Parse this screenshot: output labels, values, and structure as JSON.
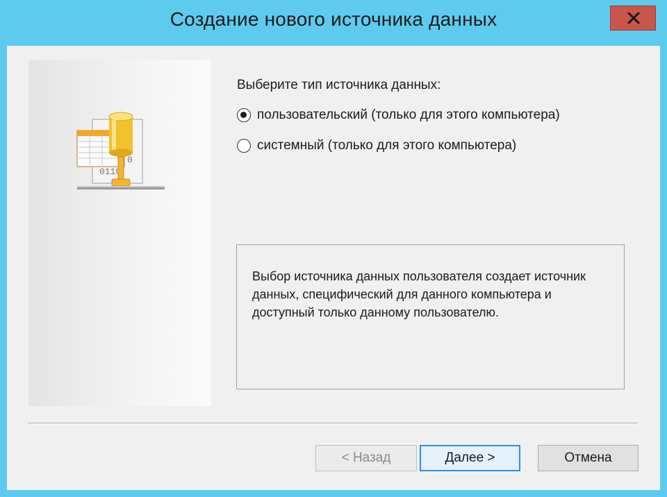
{
  "window": {
    "title": "Создание нового источника данных",
    "close_label": "x"
  },
  "icons": {
    "close": "close-icon",
    "datasource": "datasource-icon"
  },
  "main": {
    "prompt": "Выберите тип источника данных:",
    "options": [
      {
        "label": "пользовательский (только для этого компьютера)",
        "checked": true
      },
      {
        "label": "системный (только для этого компьютера)",
        "checked": false
      }
    ],
    "description": "Выбор источника данных пользователя создает источник данных, специфический для данного компьютера и доступный только данному пользователю."
  },
  "buttons": {
    "back": "< Назад",
    "next": "Далее >",
    "cancel": "Отмена"
  },
  "colors": {
    "titlebar": "#5ecbee",
    "close_button": "#c9564a",
    "default_button_border": "#2f8ee0"
  }
}
